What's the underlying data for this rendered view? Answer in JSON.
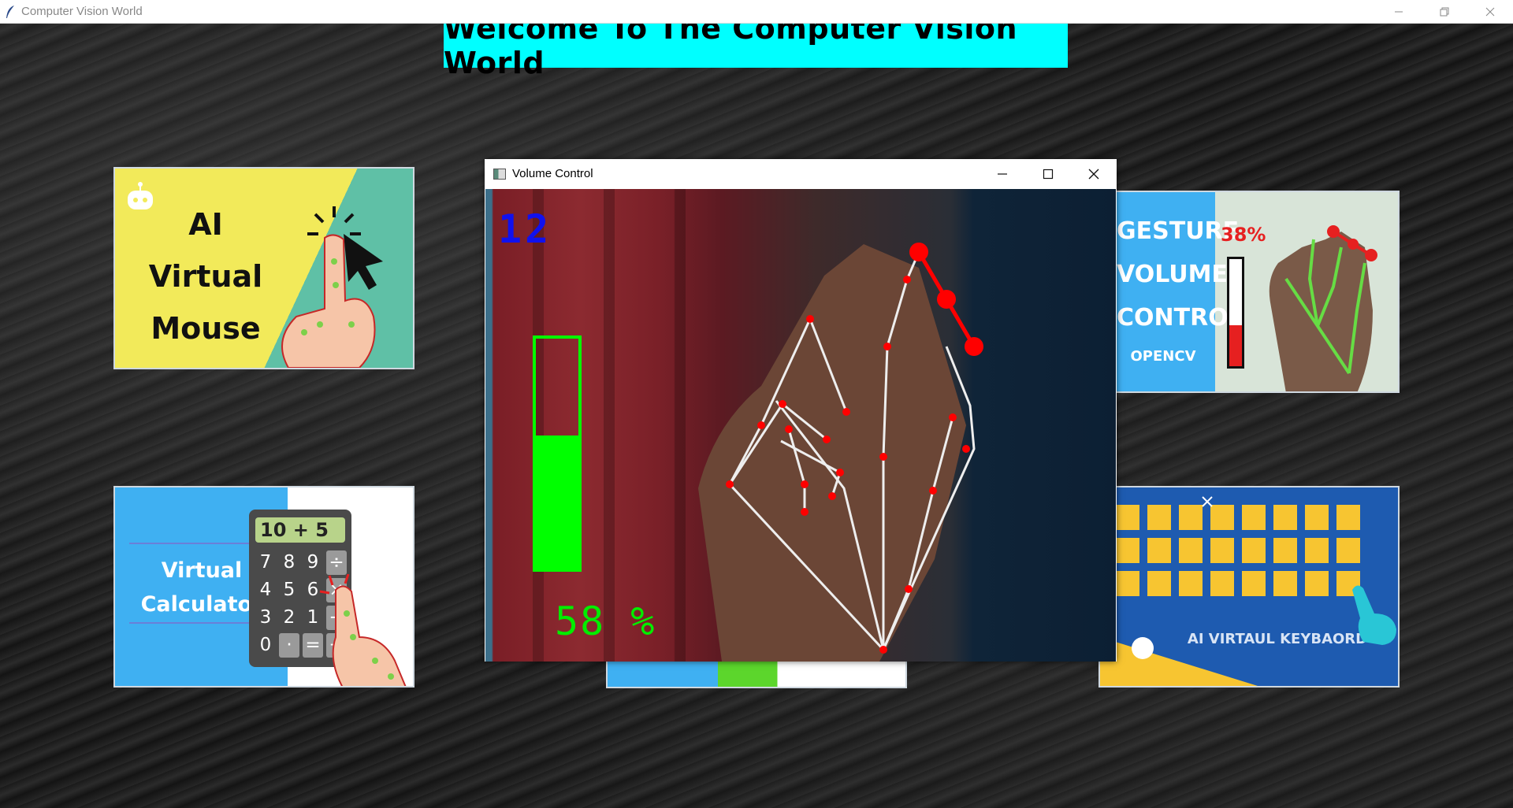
{
  "window": {
    "title": "Computer Vision World"
  },
  "banner": {
    "text": "Welcome To The Computer Vision World"
  },
  "cards": {
    "mouse": {
      "line1": "AI",
      "line2": "Virtual",
      "line3": "Mouse"
    },
    "calculator": {
      "line1": "Virtual",
      "line2": "Calculator",
      "screen": "10 + 5",
      "keys": [
        "7",
        "8",
        "9",
        "÷",
        "4",
        "5",
        "6",
        "×",
        "3",
        "2",
        "1",
        "−",
        "0",
        "·",
        "=",
        "+"
      ]
    },
    "gesture": {
      "line1": "GESTURE",
      "line2": "VOLUME",
      "line3": "CONTROL",
      "sub": "OPENCV",
      "percent": "38%",
      "level": 0.38
    },
    "keyboard": {
      "text": "AI VIRTAUL KEYBAORD"
    }
  },
  "volume_window": {
    "title": "Volume Control",
    "fps": "12",
    "volume_percent": "58 %",
    "volume_level": 0.58
  },
  "colors": {
    "banner": "#00ffff",
    "volume_bar": "#00ff00",
    "fps_text": "#1111ee",
    "landmark": "#ff0000"
  },
  "icons": {
    "app": "feather-icon",
    "window": "window-icon"
  }
}
